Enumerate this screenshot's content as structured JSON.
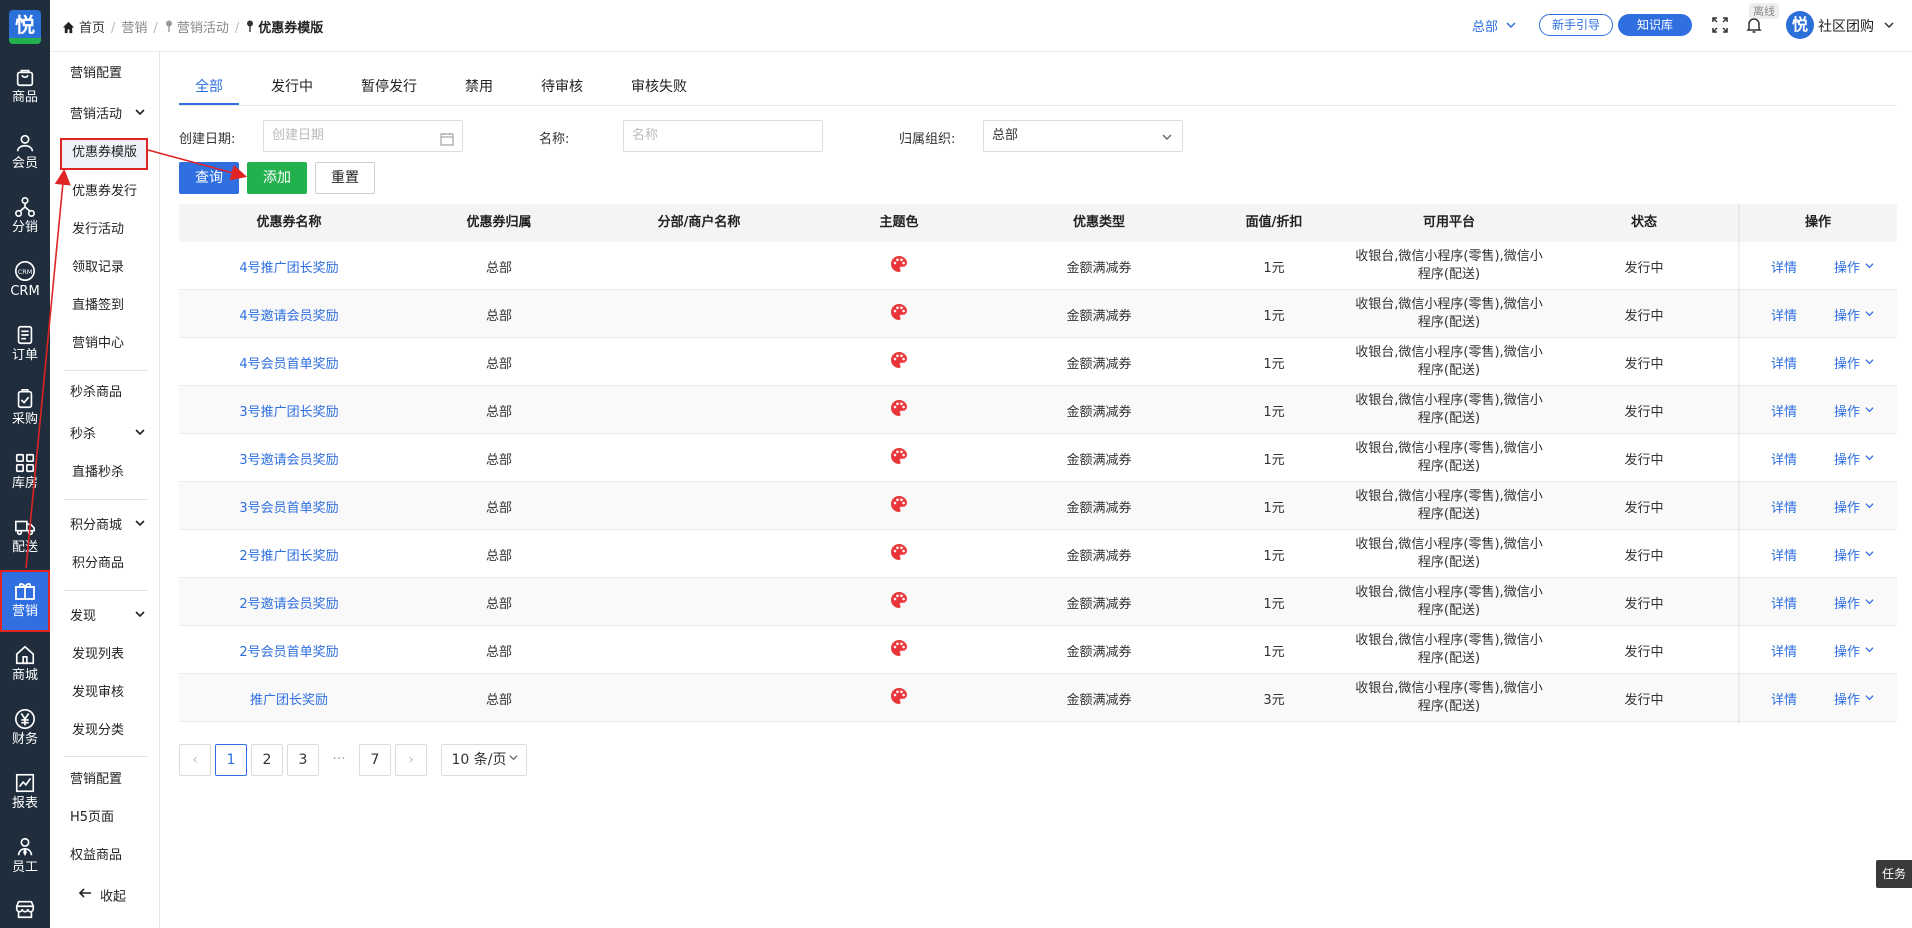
{
  "rail": {
    "logo": "悦",
    "items": [
      {
        "label": "商品",
        "icon": "bag-icon"
      },
      {
        "label": "会员",
        "icon": "user-icon"
      },
      {
        "label": "分销",
        "icon": "network-icon"
      },
      {
        "label": "CRM",
        "icon": "crm-icon"
      },
      {
        "label": "订单",
        "icon": "order-icon"
      },
      {
        "label": "采购",
        "icon": "clipboard-icon"
      },
      {
        "label": "库房",
        "icon": "grid-icon"
      },
      {
        "label": "配送",
        "icon": "truck-icon"
      },
      {
        "label": "营销",
        "icon": "gift-icon"
      },
      {
        "label": "商城",
        "icon": "home-icon"
      },
      {
        "label": "财务",
        "icon": "yen-icon"
      },
      {
        "label": "报表",
        "icon": "chart-icon"
      },
      {
        "label": "员工",
        "icon": "staff-icon"
      },
      {
        "label": "",
        "icon": "store-icon"
      }
    ]
  },
  "sidebar": {
    "items": [
      {
        "label": "营销配置"
      },
      {
        "label": "营销活动"
      },
      {
        "label": "优惠券模版"
      },
      {
        "label": "优惠券发行"
      },
      {
        "label": "发行活动"
      },
      {
        "label": "领取记录"
      },
      {
        "label": "直播签到"
      },
      {
        "label": "营销中心"
      },
      {
        "label": "秒杀商品"
      },
      {
        "label": "秒杀"
      },
      {
        "label": "直播秒杀"
      },
      {
        "label": "积分商城"
      },
      {
        "label": "积分商品"
      },
      {
        "label": "发现"
      },
      {
        "label": "发现列表"
      },
      {
        "label": "发现审核"
      },
      {
        "label": "发现分类"
      },
      {
        "label": "营销配置"
      },
      {
        "label": "H5页面"
      },
      {
        "label": "权益商品"
      }
    ],
    "collapse": "收起"
  },
  "header": {
    "breadcrumb": {
      "home": "首页",
      "l1": "营销",
      "l2": "营销活动",
      "current": "优惠券模版"
    },
    "org": "总部",
    "guide": "新手引导",
    "kb": "知识库",
    "offline": "离线",
    "avatar": "悦",
    "user": "社区团购"
  },
  "tabs": [
    "全部",
    "发行中",
    "暂停发行",
    "禁用",
    "待审核",
    "审核失败"
  ],
  "filters": {
    "date_label": "创建日期:",
    "date_placeholder": "创建日期",
    "name_label": "名称:",
    "name_placeholder": "名称",
    "org_label": "归属组织:",
    "org_value": "总部"
  },
  "buttons": {
    "query": "查询",
    "add": "添加",
    "reset": "重置"
  },
  "table": {
    "headers": [
      "优惠券名称",
      "优惠券归属",
      "分部/商户名称",
      "主题色",
      "优惠类型",
      "面值/折扣",
      "可用平台",
      "状态",
      "操作"
    ],
    "platform_line1": "收银台,微信小程序(零售),微信小",
    "platform_line2": "程序(配送)",
    "detail": "详情",
    "ops": "操作",
    "theme_color": "#e8363a",
    "rows": [
      {
        "name": "4号推广团长奖励",
        "owner": "总部",
        "branch": "",
        "type": "金额满减券",
        "value": "1元",
        "status": "发行中"
      },
      {
        "name": "4号邀请会员奖励",
        "owner": "总部",
        "branch": "",
        "type": "金额满减券",
        "value": "1元",
        "status": "发行中"
      },
      {
        "name": "4号会员首单奖励",
        "owner": "总部",
        "branch": "",
        "type": "金额满减券",
        "value": "1元",
        "status": "发行中"
      },
      {
        "name": "3号推广团长奖励",
        "owner": "总部",
        "branch": "",
        "type": "金额满减券",
        "value": "1元",
        "status": "发行中"
      },
      {
        "name": "3号邀请会员奖励",
        "owner": "总部",
        "branch": "",
        "type": "金额满减券",
        "value": "1元",
        "status": "发行中"
      },
      {
        "name": "3号会员首单奖励",
        "owner": "总部",
        "branch": "",
        "type": "金额满减券",
        "value": "1元",
        "status": "发行中"
      },
      {
        "name": "2号推广团长奖励",
        "owner": "总部",
        "branch": "",
        "type": "金额满减券",
        "value": "1元",
        "status": "发行中"
      },
      {
        "name": "2号邀请会员奖励",
        "owner": "总部",
        "branch": "",
        "type": "金额满减券",
        "value": "1元",
        "status": "发行中"
      },
      {
        "name": "2号会员首单奖励",
        "owner": "总部",
        "branch": "",
        "type": "金额满减券",
        "value": "1元",
        "status": "发行中"
      },
      {
        "name": "推广团长奖励",
        "owner": "总部",
        "branch": "",
        "type": "金额满减券",
        "value": "3元",
        "status": "发行中"
      }
    ]
  },
  "pager": {
    "prev": "‹",
    "pages": [
      "1",
      "2",
      "3"
    ],
    "ellipsis": "···",
    "last": "7",
    "next": "›",
    "size": "10 条/页"
  },
  "task": "任务",
  "colors": {
    "primary": "#2f6fe0",
    "success": "#22b14c",
    "annotation": "#e02424",
    "rail": "#1f2d3d"
  }
}
